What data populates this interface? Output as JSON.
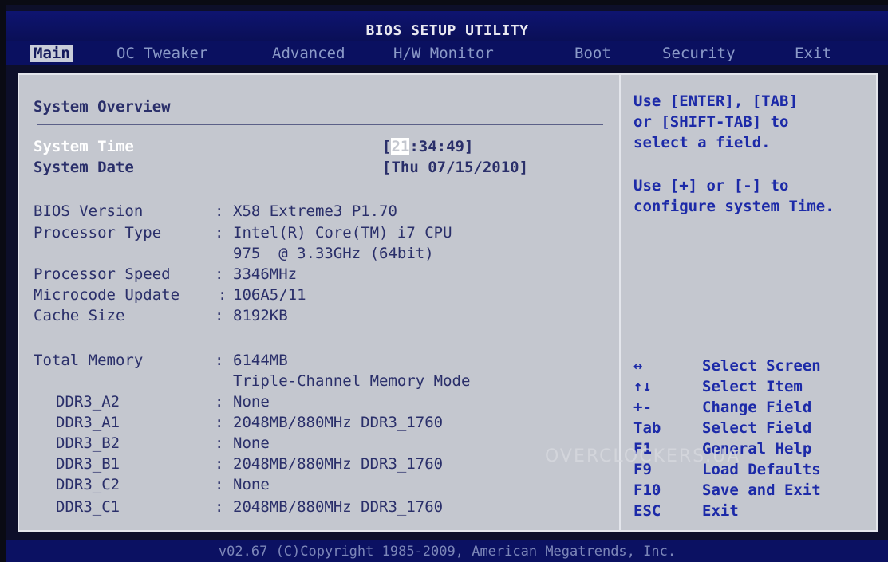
{
  "title": "BIOS SETUP UTILITY",
  "tabs": [
    "Main",
    "OC Tweaker",
    "Advanced",
    "H/W Monitor",
    "Boot",
    "Security",
    "Exit"
  ],
  "active_tab": "Main",
  "section_title": "System Overview",
  "system_time": {
    "label": "System Time",
    "value_prefix": "[",
    "selected": "21",
    "value_rest": ":34:49]"
  },
  "system_date": {
    "label": "System Date",
    "value": "[Thu 07/15/2010]"
  },
  "info": [
    {
      "label": "BIOS Version",
      "sep": ":",
      "value": "X58 Extreme3 P1.70"
    },
    {
      "label": "Processor Type",
      "sep": ":",
      "value": "Intel(R) Core(TM) i7 CPU"
    },
    {
      "label": "",
      "sep": "",
      "value": "975  @ 3.33GHz (64bit)"
    },
    {
      "label": "Processor Speed",
      "sep": ":",
      "value": "3346MHz"
    },
    {
      "label": "Microcode Update",
      "sep": ":",
      "value": "106A5/11"
    },
    {
      "label": "Cache Size",
      "sep": ":",
      "value": "8192KB"
    }
  ],
  "memory": {
    "label": "Total Memory",
    "sep": ":",
    "value": "6144MB",
    "mode": "Triple-Channel Memory Mode",
    "slots": [
      {
        "label": "DDR3_A2",
        "sep": ":",
        "value": "None"
      },
      {
        "label": "DDR3_A1",
        "sep": ":",
        "value": "2048MB/880MHz DDR3_1760"
      },
      {
        "label": "DDR3_B2",
        "sep": ":",
        "value": "None"
      },
      {
        "label": "DDR3_B1",
        "sep": ":",
        "value": "2048MB/880MHz DDR3_1760"
      },
      {
        "label": "DDR3_C2",
        "sep": ":",
        "value": "None"
      },
      {
        "label": "DDR3_C1",
        "sep": ":",
        "value": "2048MB/880MHz DDR3_1760"
      }
    ]
  },
  "help": {
    "lines1": [
      "Use [ENTER], [TAB]",
      "or [SHIFT-TAB] to",
      "select a field."
    ],
    "lines2": [
      "Use [+] or [-] to",
      "configure system Time."
    ]
  },
  "keys": [
    {
      "key": "↔",
      "desc": "Select Screen"
    },
    {
      "key": "↑↓",
      "desc": "Select Item"
    },
    {
      "key": "+-",
      "desc": "Change Field"
    },
    {
      "key": "Tab",
      "desc": "Select Field"
    },
    {
      "key": "F1",
      "desc": "General Help"
    },
    {
      "key": "F9",
      "desc": "Load Defaults"
    },
    {
      "key": "F10",
      "desc": "Save and Exit"
    },
    {
      "key": "ESC",
      "desc": "Exit"
    }
  ],
  "watermark": "OVERCLOCKERS.UA",
  "footer": "v02.67 (C)Copyright 1985-2009, American Megatrends, Inc.",
  "colors": {
    "panel": "#c4c7cf",
    "title_bar": "#0e1470",
    "text": "#2a2f6a",
    "help_text": "#1c2aa8",
    "highlight": "#ffffff"
  }
}
